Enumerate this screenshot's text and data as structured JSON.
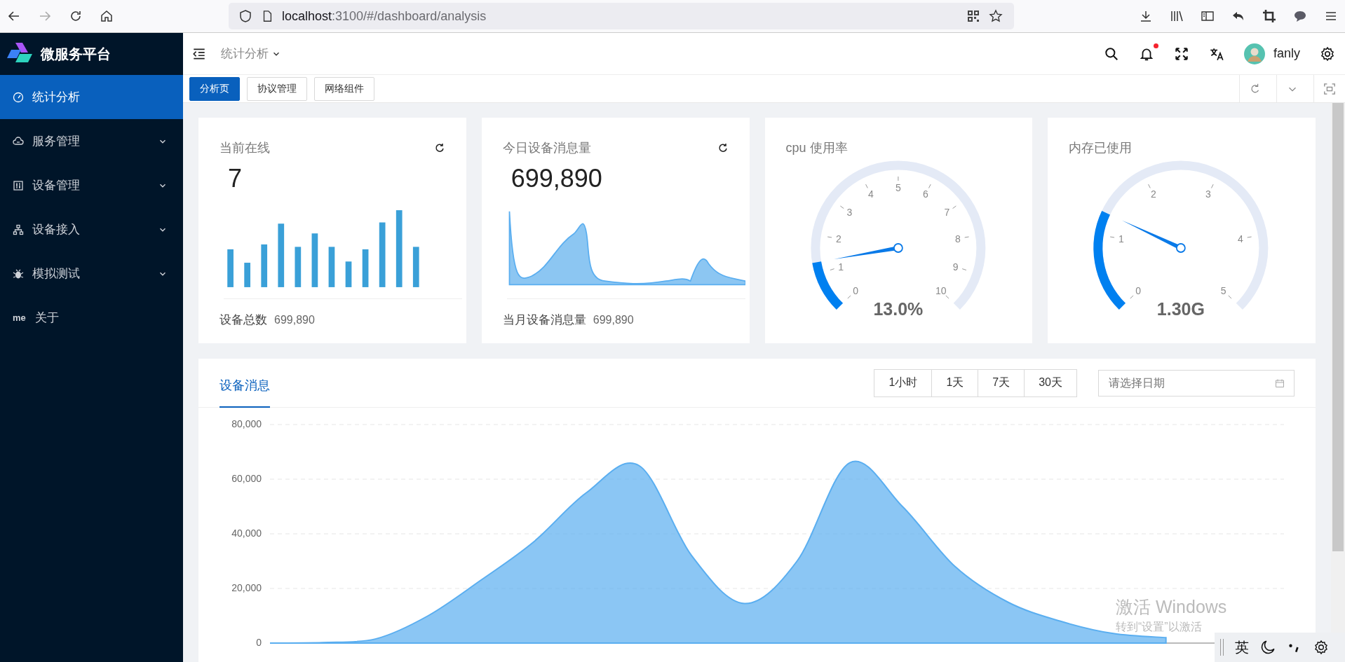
{
  "browser": {
    "url_host": "localhost",
    "url_path": ":3100/#/dashboard/analysis"
  },
  "sidebar": {
    "logo": "微服务平台",
    "items": [
      {
        "label": "统计分析",
        "selected": true,
        "expandable": false
      },
      {
        "label": "服务管理",
        "selected": false,
        "expandable": true
      },
      {
        "label": "设备管理",
        "selected": false,
        "expandable": true
      },
      {
        "label": "设备接入",
        "selected": false,
        "expandable": true
      },
      {
        "label": "模拟测试",
        "selected": false,
        "expandable": true
      },
      {
        "label": "关于",
        "selected": false,
        "expandable": false,
        "icon_text": "me"
      }
    ]
  },
  "header": {
    "breadcrumb": "统计分析",
    "notification_dot": true,
    "user": "fanly"
  },
  "tabs": [
    {
      "label": "分析页",
      "selected": true
    },
    {
      "label": "协议管理",
      "selected": false
    },
    {
      "label": "网络组件",
      "selected": false
    }
  ],
  "cards": [
    {
      "kind": "bars",
      "title": "当前在线",
      "value": "7",
      "footer_label": "设备总数",
      "footer_value": "699,890"
    },
    {
      "kind": "area",
      "title": "今日设备消息量",
      "value": "699,890",
      "footer_label": "当月设备消息量",
      "footer_value": "699,890"
    },
    {
      "kind": "gauge",
      "title": "cpu 使用率",
      "level": 0.13,
      "reading": "13.0%",
      "ticks": [
        "0",
        "1",
        "2",
        "3",
        "4",
        "5",
        "6",
        "7",
        "8",
        "9",
        "10"
      ]
    },
    {
      "kind": "gauge",
      "title": "内存已使用",
      "level": 0.26,
      "reading": "1.30G",
      "ticks": [
        "0",
        "1",
        "2",
        "3",
        "4",
        "5"
      ]
    }
  ],
  "messages": {
    "tab": "设备消息",
    "ranges": [
      {
        "label": "1小时",
        "selected": false
      },
      {
        "label": "1天",
        "selected": false
      },
      {
        "label": "7天",
        "selected": false
      },
      {
        "label": "30天",
        "selected": false
      }
    ],
    "date_placeholder": "请选择日期",
    "chart_data": {
      "type": "area",
      "grid": true,
      "yticks": [
        {
          "value": 0,
          "label": "0"
        },
        {
          "value": 20000,
          "label": "20,000"
        },
        {
          "value": 40000,
          "label": "40,000"
        },
        {
          "value": 60000,
          "label": "60,000"
        },
        {
          "value": 80000,
          "label": "80,000"
        }
      ],
      "ylim": [
        0,
        80000
      ],
      "series": [
        {
          "color": "#5aaef0",
          "values": [
            0,
            200,
            1500,
            10000,
            23000,
            37000,
            55000,
            65000,
            32000,
            14500,
            30000,
            66000,
            50000,
            28000,
            15000,
            8000,
            3500,
            2000,
            null,
            null
          ]
        }
      ]
    }
  },
  "system": {
    "activation_title": "激活 Windows",
    "activation_hint": "转到“设置”以激活",
    "ime_mode": "英"
  }
}
